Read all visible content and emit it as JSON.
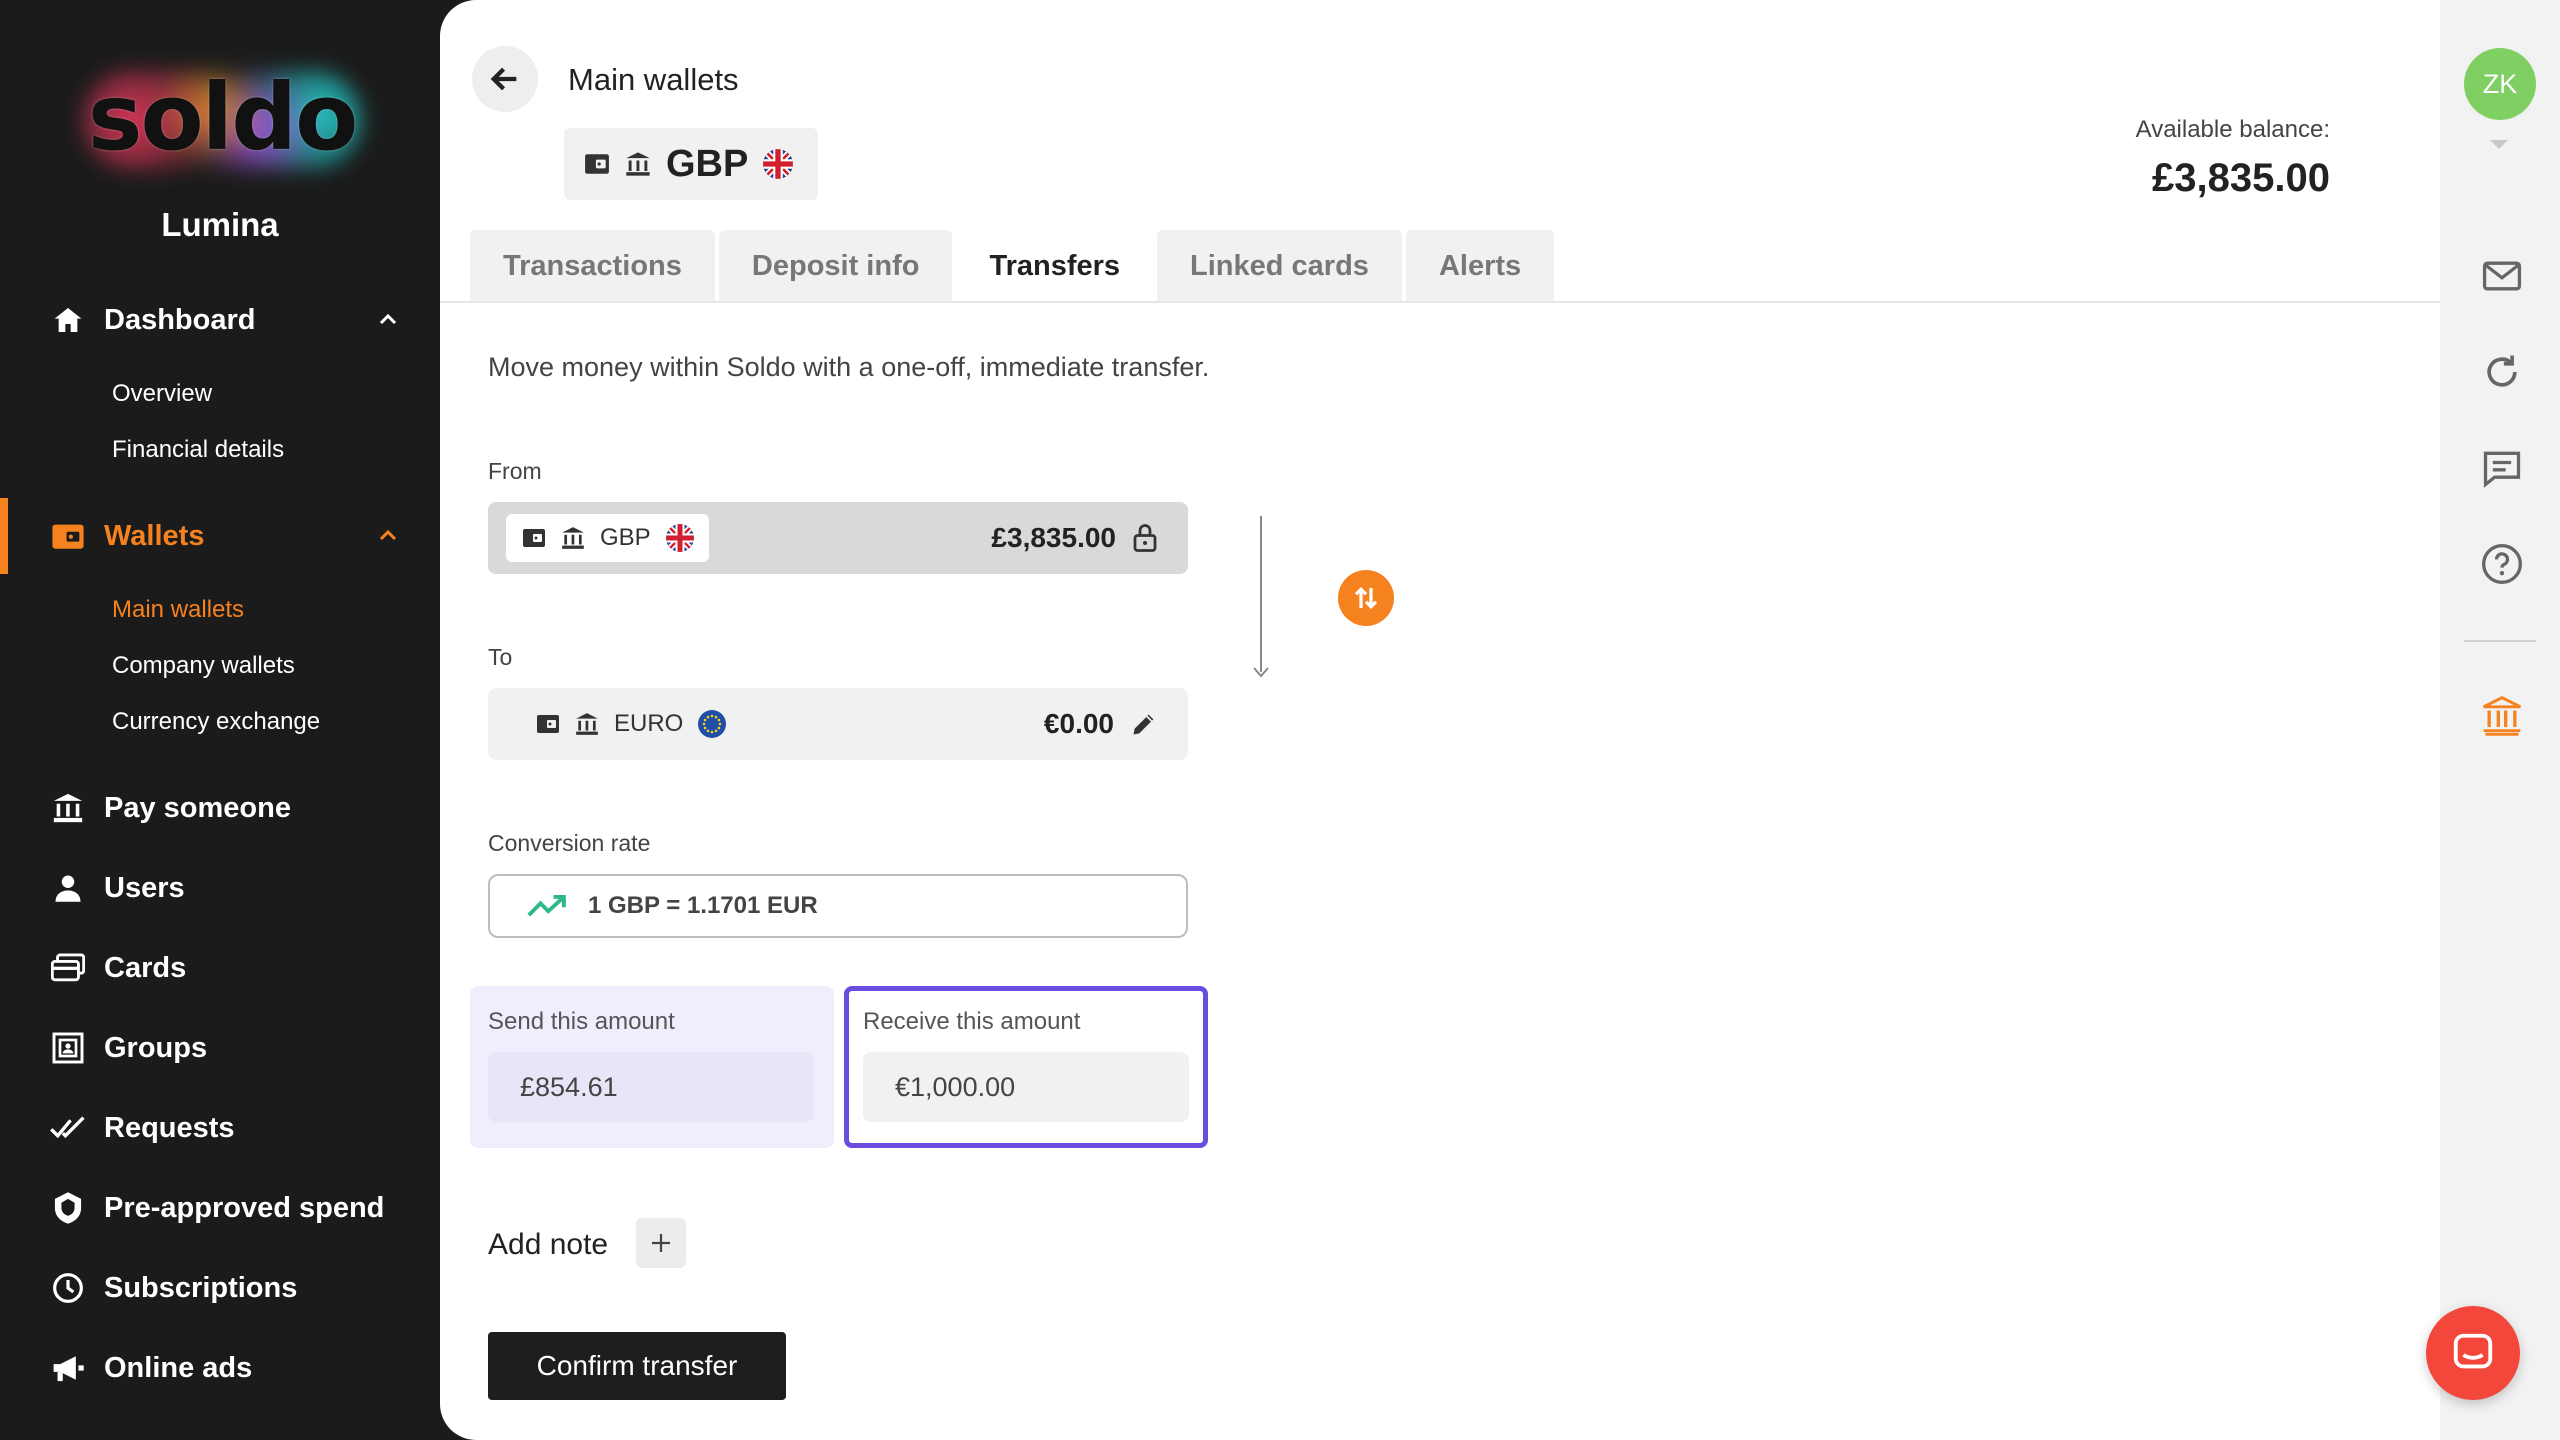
{
  "brand": {
    "logo": "soldo",
    "org": "Lumina"
  },
  "sidebar": {
    "dashboard": {
      "label": "Dashboard",
      "sub": [
        "Overview",
        "Financial details"
      ]
    },
    "wallets": {
      "label": "Wallets",
      "sub": [
        "Main wallets",
        "Company wallets",
        "Currency exchange"
      ]
    },
    "items": [
      "Pay someone",
      "Users",
      "Cards",
      "Groups",
      "Requests",
      "Pre-approved spend",
      "Subscriptions",
      "Online ads"
    ]
  },
  "header": {
    "title": "Main wallets",
    "wallet_currency": "GBP",
    "balance_label": "Available balance:",
    "balance_value": "£3,835.00"
  },
  "tabs": [
    "Transactions",
    "Deposit info",
    "Transfers",
    "Linked cards",
    "Alerts"
  ],
  "active_tab": "Transfers",
  "transfer": {
    "intro": "Move money within Soldo with a one-off, immediate transfer.",
    "from_label": "From",
    "from_currency": "GBP",
    "from_amount": "£3,835.00",
    "to_label": "To",
    "to_currency": "EURO",
    "to_amount": "€0.00",
    "rate_label": "Conversion rate",
    "rate_value": "1 GBP = 1.1701 EUR",
    "send_label": "Send this amount",
    "send_value": "£854.61",
    "receive_label": "Receive this amount",
    "receive_value": "€1,000.00",
    "add_note_label": "Add note",
    "confirm_label": "Confirm transfer"
  },
  "user": {
    "initials": "ZK"
  },
  "colors": {
    "accent": "#f5821f",
    "focus": "#6a4ddf",
    "avatar": "#7fcf63",
    "chat": "#f4473b"
  }
}
